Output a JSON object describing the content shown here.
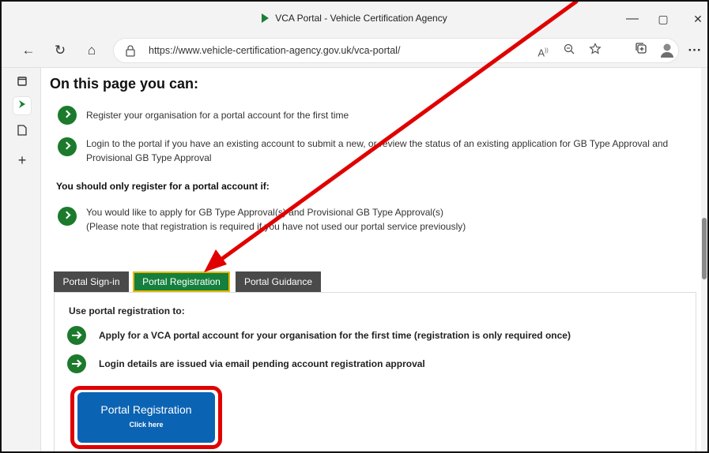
{
  "browser": {
    "window_title": "VCA Portal - Vehicle Certification Agency",
    "url": "https://www.vehicle-certification-agency.gov.uk/vca-portal/",
    "controls": {
      "minimize": "—",
      "maximize": "▢",
      "close": "✕"
    },
    "nav": {
      "back": "←",
      "refresh": "↻",
      "home": "⌂"
    },
    "url_icons": [
      "read-aloud-icon",
      "zoom-icon",
      "favorites-icon"
    ],
    "toolbar_icons": [
      "collections-icon",
      "profile-icon",
      "more-icon"
    ],
    "more_glyph": "···"
  },
  "sidebar": {
    "items": [
      {
        "icon": "tab-actions-icon"
      },
      {
        "icon": "vca-favicon-icon",
        "active": true
      },
      {
        "icon": "page-icon"
      },
      {
        "icon": "add-icon"
      }
    ]
  },
  "page": {
    "heading": "On this page you can:",
    "items": [
      {
        "text": "Register your organisation for a portal account for the first time"
      },
      {
        "text": "Login to the portal if you have an existing account to submit a new, or review the status of an existing application for GB Type Approval and Provisional GB Type Approval"
      }
    ],
    "register_if_heading": "You should only register for a portal account if:",
    "register_if_items": [
      {
        "line1": "You would like to apply for GB Type Approval(s) and Provisional GB Type Approval(s)",
        "line2": "(Please note that registration is required if you have not used our portal service previously)"
      }
    ]
  },
  "tabs": [
    {
      "label": "Portal Sign-in",
      "active": false
    },
    {
      "label": "Portal Registration",
      "active": true
    },
    {
      "label": "Portal Guidance",
      "active": false
    }
  ],
  "panel": {
    "label": "Use portal registration to:",
    "items": [
      {
        "text": "Apply for a VCA portal account for your organisation for the first time (registration is only required once)"
      },
      {
        "text": "Login details are issued via email pending account registration approval"
      }
    ],
    "button": {
      "main": "Portal Registration",
      "sub": "Click here"
    }
  },
  "colors": {
    "accent_green": "#15803d",
    "tab_dark": "#4a4a4a",
    "button_blue": "#0b63b3",
    "annotation_red": "#e00000",
    "tab_outline": "#e6b800"
  }
}
